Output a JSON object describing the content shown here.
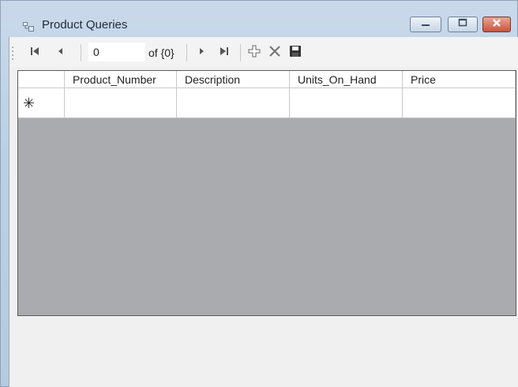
{
  "window": {
    "title": "Product Queries"
  },
  "navigator": {
    "position": "0",
    "count_label": "of {0}"
  },
  "grid": {
    "columns": [
      "Product_Number",
      "Description",
      "Units_On_Hand",
      "Price"
    ],
    "new_row_marker": "✳"
  },
  "icons": {
    "app": "form-icon",
    "minimize": "minimize-icon",
    "maximize": "maximize-icon",
    "close": "close-icon",
    "first": "move-first-icon",
    "previous": "move-previous-icon",
    "next": "move-next-icon",
    "last": "move-last-icon",
    "add": "add-new-icon",
    "delete": "delete-icon",
    "save": "save-icon"
  },
  "colors": {
    "grid_background": "#a9abaf",
    "close_button": "#c8553e"
  }
}
